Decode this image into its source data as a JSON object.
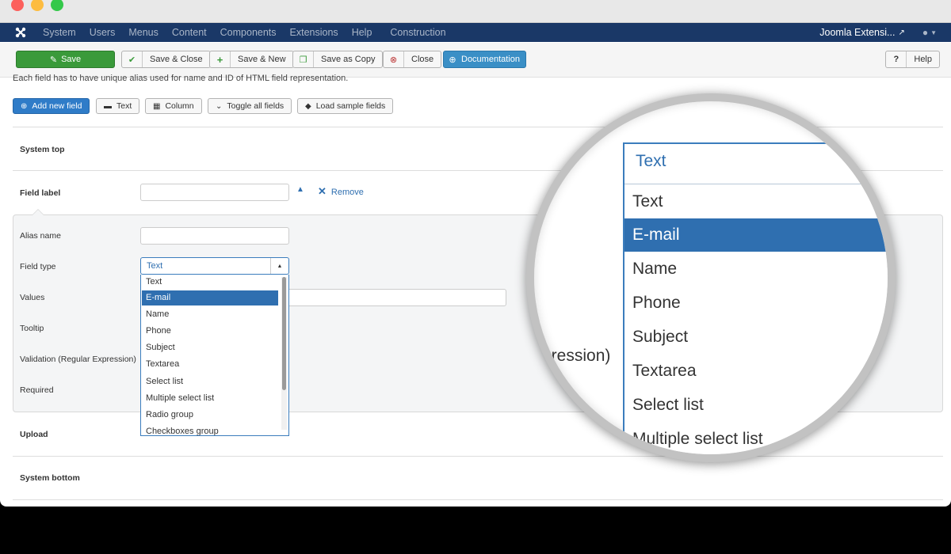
{
  "navbar": {
    "items": [
      "System",
      "Users",
      "Menus",
      "Content",
      "Components",
      "Extensions",
      "Help",
      "Construction"
    ],
    "site_link": "Joomla Extensi..."
  },
  "toolbar": {
    "save": "Save",
    "save_close": "Save & Close",
    "save_new": "Save & New",
    "save_copy": "Save as Copy",
    "close": "Close",
    "documentation": "Documentation",
    "help": "Help"
  },
  "content": {
    "description": "Each field has to have unique alias used for name and ID of HTML field representation.",
    "actions": {
      "add_new_field": "Add new field",
      "text": "Text",
      "column": "Column",
      "toggle_all": "Toggle all fields",
      "load_sample": "Load sample fields"
    },
    "sections": {
      "system_top": "System top",
      "field_label": "Field label",
      "upload": "Upload",
      "system_bottom": "System bottom"
    },
    "remove_label": "Remove",
    "field_labels": {
      "alias_name": "Alias name",
      "field_type": "Field type",
      "values": "Values",
      "tooltip": "Tooltip",
      "validation": "Validation (Regular Expression)",
      "required": "Required"
    },
    "field_type": {
      "selected": "Text",
      "highlighted": "E-mail",
      "options": [
        "Text",
        "E-mail",
        "Name",
        "Phone",
        "Subject",
        "Textarea",
        "Select list",
        "Multiple select list",
        "Radio group",
        "Checkboxes group"
      ]
    }
  },
  "magnifier": {
    "selected": "Text",
    "options": [
      "Text",
      "E-mail",
      "Name",
      "Phone",
      "Subject",
      "Textarea",
      "Select list",
      "Multiple select list"
    ],
    "background_text": "pression)"
  },
  "colors": {
    "navbar": "#1a3867",
    "save_green": "#3a9a3a",
    "primary_blue": "#2f7cc8",
    "selection": "#2f6fb0"
  }
}
